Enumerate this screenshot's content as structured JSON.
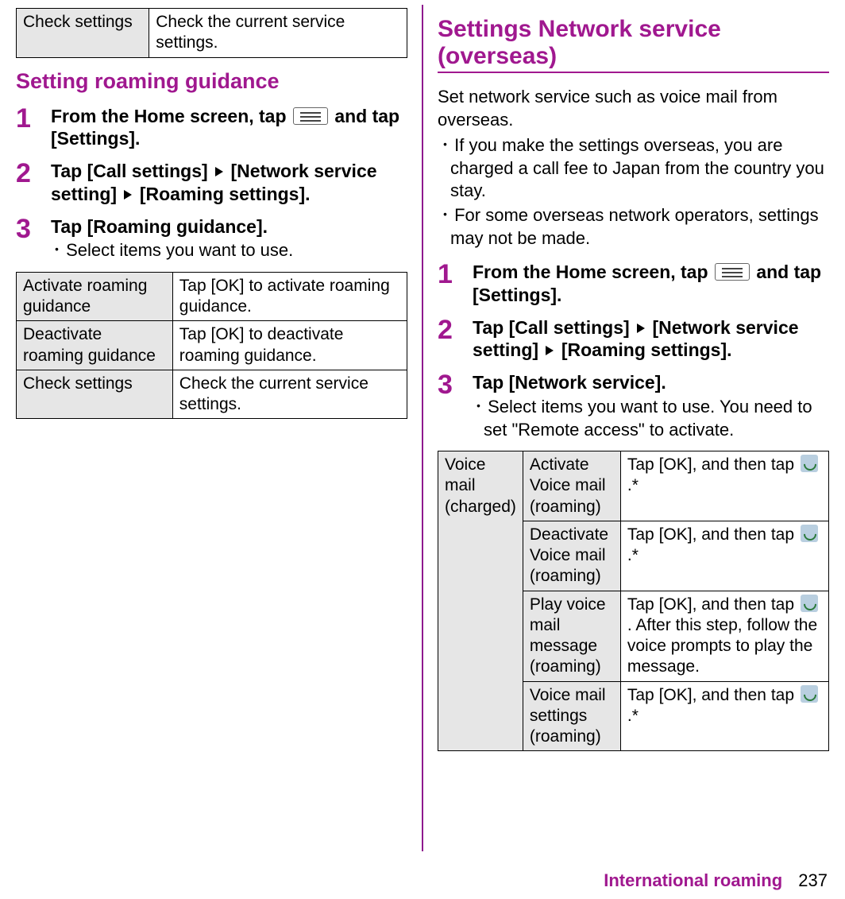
{
  "left": {
    "top_table": {
      "label": "Check settings",
      "desc": "Check the current service settings."
    },
    "heading": "Setting roaming guidance",
    "steps": [
      {
        "num": "1",
        "title_pre": "From the Home screen, tap ",
        "title_post": " and tap [Settings]."
      },
      {
        "num": "2",
        "title_parts": [
          "Tap [Call settings]",
          "[Network service setting]",
          "[Roaming settings]."
        ]
      },
      {
        "num": "3",
        "title": "Tap [Roaming guidance].",
        "note": "･ Select items you want to use."
      }
    ],
    "table": [
      {
        "label": "Activate roaming guidance",
        "desc": "Tap [OK] to activate roaming guidance."
      },
      {
        "label": "Deactivate roaming guidance",
        "desc": "Tap [OK] to deactivate roaming guidance."
      },
      {
        "label": "Check settings",
        "desc": "Check the current service settings."
      }
    ]
  },
  "right": {
    "heading": "Settings Network service (overseas)",
    "intro": "Set network service such as voice mail from overseas.",
    "bullets": [
      "･ If you make the settings overseas, you are charged a call fee to Japan from the country you stay.",
      "･ For some overseas network operators, settings may not be made."
    ],
    "steps": [
      {
        "num": "1",
        "title_pre": "From the Home screen, tap ",
        "title_post": " and tap [Settings]."
      },
      {
        "num": "2",
        "title_parts": [
          "Tap [Call settings]",
          "[Network service setting]",
          "[Roaming settings]."
        ]
      },
      {
        "num": "3",
        "title": "Tap [Network service].",
        "note": "･ Select items you want to use. You need to set \"Remote access\" to activate."
      }
    ],
    "table": {
      "group": "Voice mail (charged)",
      "rows": [
        {
          "label": "Activate Voice mail (roaming)",
          "desc_pre": "Tap [OK], and then tap ",
          "desc_post": ".*"
        },
        {
          "label": "Deactivate Voice mail (roaming)",
          "desc_pre": "Tap [OK], and then tap ",
          "desc_post": ".*"
        },
        {
          "label": "Play voice mail message (roaming)",
          "desc_pre": "Tap [OK], and then tap ",
          "desc_post": ". After this step, follow the voice prompts to play the message."
        },
        {
          "label": "Voice mail settings (roaming)",
          "desc_pre": "Tap [OK], and then tap ",
          "desc_post": ".*"
        }
      ]
    }
  },
  "footer": {
    "section": "International roaming",
    "page": "237"
  }
}
